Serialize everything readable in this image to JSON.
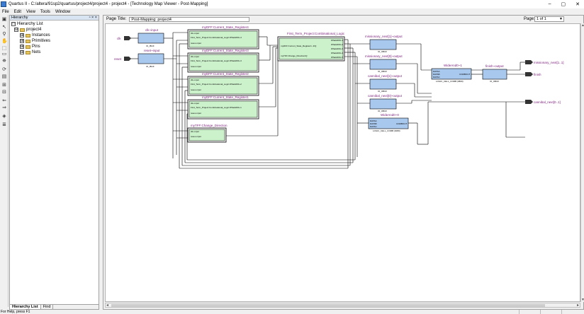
{
  "window": {
    "title": "Quartus II - C:/altera/91sp2/quartus/project4/project4 - project4 - [Technology Map Viewer - Post-Mapping]",
    "controls": [
      "–",
      "▢",
      "✕"
    ]
  },
  "menu": [
    "File",
    "Edit",
    "View",
    "Tools",
    "Window"
  ],
  "hierarchy": {
    "header": "Hierarchy",
    "pin_glyph": "▫ × ×",
    "items": [
      {
        "label": "Hierarchy List",
        "expander": "□"
      },
      {
        "label": "project4",
        "expander": "⊟"
      },
      {
        "label": "Instances",
        "expander": "⊞"
      },
      {
        "label": "Primitives",
        "expander": "⊞"
      },
      {
        "label": "Pins",
        "expander": "⊞"
      },
      {
        "label": "Nets",
        "expander": "⊞"
      }
    ],
    "tabs": [
      "Hierarchy List",
      "Find"
    ]
  },
  "viewer": {
    "page_title_label": "Page Title:",
    "page_title_value": "Post-Mapping: project4",
    "page_label": "Page:",
    "page_value": "1 of 1"
  },
  "schematic": {
    "inputs": [
      {
        "port": "clk",
        "block": "clk~input",
        "sub": "IO_IBUF"
      },
      {
        "port": "reset",
        "block": "reset~input",
        "sub": "IO_IBUF"
      }
    ],
    "registers": [
      {
        "name": "myDFF:Current_State_Register4",
        "lines": [
          "clk~input",
          "First_Term_Project:Combinational_Logic:Whats000~4",
          "reset~input"
        ]
      },
      {
        "name": "myDFF:Current_State_Register3",
        "lines": [
          "clk~input",
          "First_Term_Project:Combinational_Logic:Whats000~3",
          "reset~input"
        ]
      },
      {
        "name": "myDFF:Current_State_Register2",
        "lines": [
          "clk~input",
          "First_Term_Project:Combinational_Logic:Whats000~2",
          "reset~input"
        ]
      },
      {
        "name": "myDFF:Current_State_Register1",
        "lines": [
          "clk~input",
          "First_Term_Project:Combinational_Logic:Whats000~1",
          "reset~input"
        ]
      },
      {
        "name": "myTFF:Change_Direction",
        "lines": [
          "clk~input",
          "reset~input"
        ]
      }
    ],
    "comb_logic": {
      "name": "First_Term_Project:Combinational_Logic",
      "ins": [
        "myDFF:Current_State_Register1..4/Q",
        "myTFF:Change_Direction/Q"
      ],
      "outs": [
        "Whats000~1",
        "Whats000~2",
        "Whats000~3",
        "Whats000~4",
        "Whats000~5"
      ]
    },
    "obufs": [
      {
        "name": "missionary_next[1]~output",
        "sub": "IO_OBUF"
      },
      {
        "name": "missionary_next[0]~output",
        "sub": "IO_OBUF"
      },
      {
        "name": "cannibal_next[1]~output",
        "sub": "IO_OBUF"
      },
      {
        "name": "cannibal_next[0]~output",
        "sub": "IO_OBUF"
      },
      {
        "name": "finish~output",
        "sub": "IO_OBUF"
      }
    ],
    "and_cells": [
      {
        "name": "WideAnd0~1",
        "ins": [
          "DATAA",
          "DATAB",
          "DATAC"
        ],
        "out": "COMBOUT",
        "sub": "LOGIC_CELL_COMB (0800)"
      },
      {
        "name": "WideAnd0~0",
        "ins": [
          "DATAA",
          "DATAB",
          "DATAC"
        ],
        "out": "COMBOUT",
        "sub": "LOGIC_CELL_COMB (0080)"
      }
    ],
    "outputs": [
      {
        "port": "missionary_next[1..1]"
      },
      {
        "port": "finish"
      },
      {
        "port": "cannibal_next[0..1]"
      }
    ]
  },
  "status": {
    "text": "For Help, press F1"
  }
}
